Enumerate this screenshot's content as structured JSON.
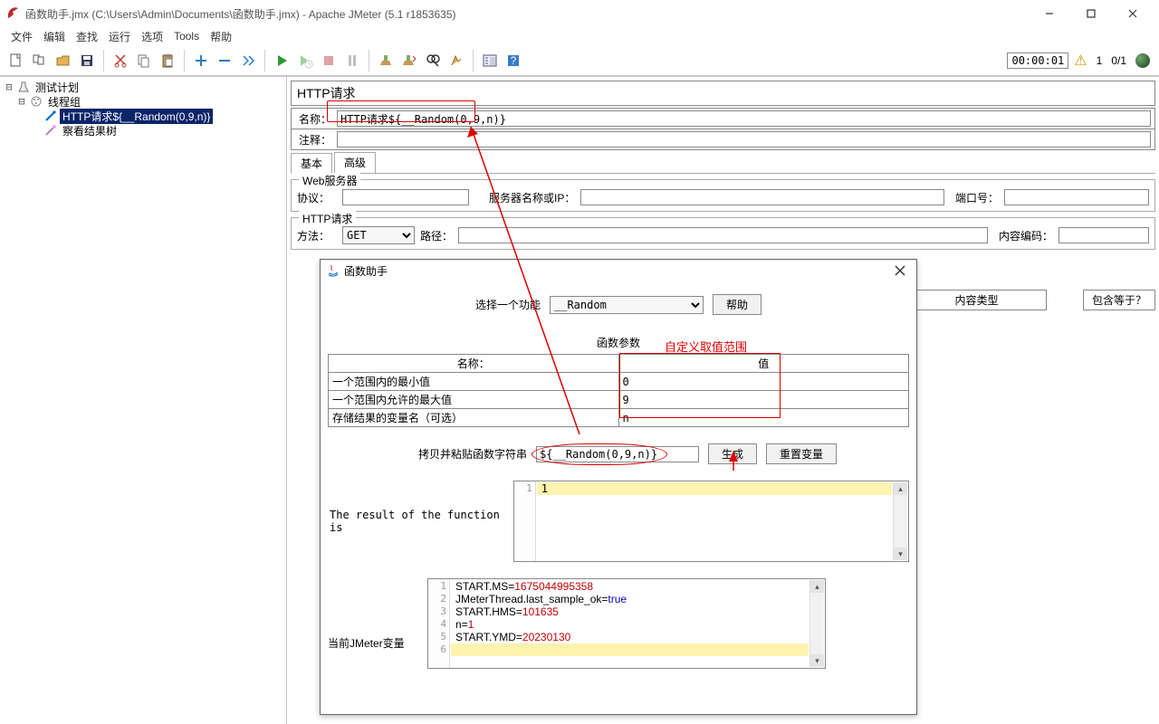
{
  "window": {
    "title": "函数助手.jmx (C:\\Users\\Admin\\Documents\\函数助手.jmx) - Apache JMeter (5.1 r1853635)"
  },
  "menu": {
    "file": "文件",
    "edit": "编辑",
    "find": "查找",
    "run": "运行",
    "options": "选项",
    "tools": "Tools",
    "help": "帮助"
  },
  "status": {
    "timer": "00:00:01",
    "warn": "1",
    "threads": "0/1"
  },
  "tree": {
    "plan": "测试计划",
    "group": "线程组",
    "http": "HTTP请求${__Random(0,9,n)}",
    "listener": "察看结果树"
  },
  "http": {
    "title": "HTTP请求",
    "name_label": "名称：",
    "name_value": "HTTP请求${__Random(0,9,n)}",
    "comment_label": "注释：",
    "tab_basic": "基本",
    "tab_adv": "高级",
    "web_server": "Web服务器",
    "protocol": "协议：",
    "server": "服务器名称或IP：",
    "port": "端口号：",
    "request": "HTTP请求",
    "method": "方法：",
    "method_value": "GET",
    "path": "路径：",
    "encoding": "内容编码：",
    "col1": "内容类型",
    "col2": "包含等于？"
  },
  "dlg": {
    "title": "函数助手",
    "select_label": "选择一个功能",
    "select_value": "__Random",
    "help_btn": "帮助",
    "params_title": "函数参数",
    "annotation": "自定义取值范围",
    "col_name": "名称：",
    "col_value": "值",
    "rows": [
      {
        "name": "一个范围内的最小值",
        "value": "0"
      },
      {
        "name": "一个范围内允许的最大值",
        "value": "9"
      },
      {
        "name": "存储结果的变量名（可选）",
        "value": "n"
      }
    ],
    "copy_label": "拷贝并粘贴函数字符串",
    "func_string": "${__Random(0,9,n)}",
    "gen_btn": "生成",
    "reset_btn": "重置变量",
    "result_label": "The result of the function is",
    "result_value": "1",
    "vars_label": "当前JMeter变量",
    "vars": [
      {
        "ln": 1,
        "t": "START.MS=",
        "v": "1675044995358",
        "cls": "num"
      },
      {
        "ln": 2,
        "t": "JMeterThread.last_sample_ok=",
        "v": "true",
        "cls": "bool"
      },
      {
        "ln": 3,
        "t": "START.HMS=",
        "v": "101635",
        "cls": "num"
      },
      {
        "ln": 4,
        "t": "n=",
        "v": "1",
        "cls": "num"
      },
      {
        "ln": 5,
        "t": "START.YMD=",
        "v": "20230130",
        "cls": "num"
      },
      {
        "ln": 6,
        "t": "",
        "v": "",
        "cls": ""
      }
    ]
  },
  "icons": {
    "feather": "feather"
  }
}
